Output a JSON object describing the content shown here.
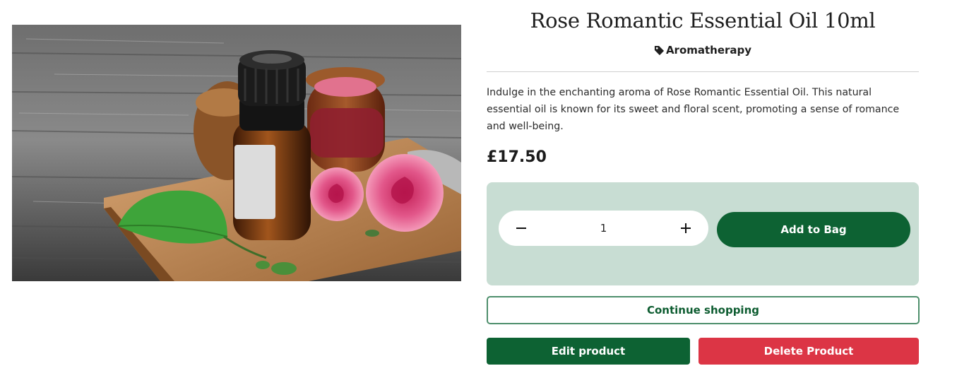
{
  "product": {
    "title": "Rose Romantic Essential Oil 10ml",
    "category": "Aromatherapy",
    "category_icon": "tag-icon",
    "description": "Indulge in the enchanting aroma of Rose Romantic Essential Oil. This natural essential oil is known for its sweet and floral scent, promoting a sense of romance and well-being.",
    "price": "£17.50",
    "image_icon": "product-photo"
  },
  "purchase": {
    "quantity": "1",
    "minus_label": "−",
    "plus_label": "+",
    "add_to_bag_label": "Add to Bag"
  },
  "actions": {
    "continue_label": "Continue shopping",
    "edit_label": "Edit product",
    "delete_label": "Delete Product"
  },
  "colors": {
    "primary_green": "#0d6233",
    "panel_bg": "#c8ddd3",
    "danger_red": "#dc3545"
  }
}
